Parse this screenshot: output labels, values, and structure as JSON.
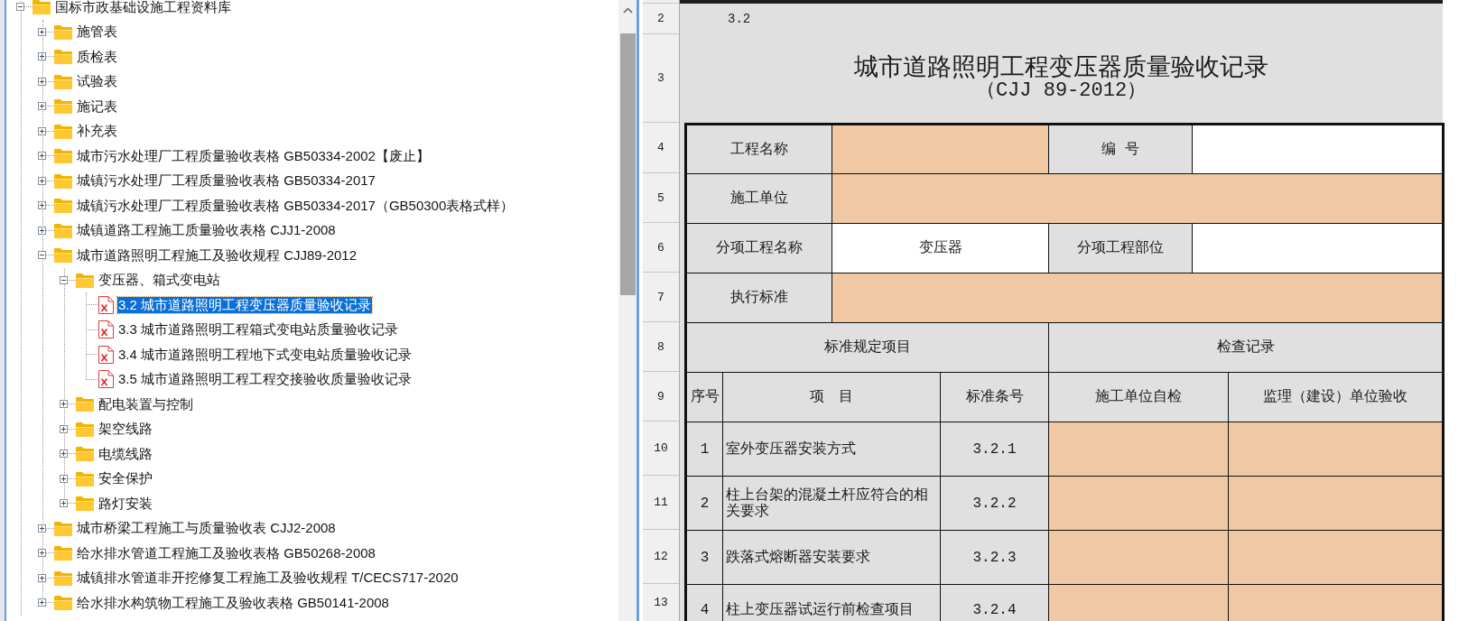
{
  "tree": [
    {
      "kind": "folder",
      "label": "国标市政基础设施工程资料库",
      "expanded": true,
      "selected": false,
      "children": [
        {
          "kind": "folder",
          "label": "施管表",
          "expanded": false,
          "selected": false
        },
        {
          "kind": "folder",
          "label": "质检表",
          "expanded": false,
          "selected": false
        },
        {
          "kind": "folder",
          "label": "试验表",
          "expanded": false,
          "selected": false
        },
        {
          "kind": "folder",
          "label": "施记表",
          "expanded": false,
          "selected": false
        },
        {
          "kind": "folder",
          "label": "补充表",
          "expanded": false,
          "selected": false
        },
        {
          "kind": "folder",
          "label": "城市污水处理厂工程质量验收表格 GB50334-2002【废止】",
          "expanded": false,
          "selected": false
        },
        {
          "kind": "folder",
          "label": "城镇污水处理厂工程质量验收表格 GB50334-2017",
          "expanded": false,
          "selected": false
        },
        {
          "kind": "folder",
          "label": "城镇污水处理厂工程质量验收表格 GB50334-2017（GB50300表格式样）",
          "expanded": false,
          "selected": false
        },
        {
          "kind": "folder",
          "label": "城镇道路工程施工质量验收表格 CJJ1-2008",
          "expanded": false,
          "selected": false
        },
        {
          "kind": "folder",
          "label": "城市道路照明工程施工及验收规程 CJJ89-2012",
          "expanded": true,
          "selected": false,
          "children": [
            {
              "kind": "folder",
              "label": "变压器、箱式变电站",
              "expanded": true,
              "selected": false,
              "children": [
                {
                  "kind": "file",
                  "label": "3.2 城市道路照明工程变压器质量验收记录",
                  "selected": true
                },
                {
                  "kind": "file",
                  "label": "3.3 城市道路照明工程箱式变电站质量验收记录",
                  "selected": false
                },
                {
                  "kind": "file",
                  "label": "3.4 城市道路照明工程地下式变电站质量验收记录",
                  "selected": false
                },
                {
                  "kind": "file",
                  "label": "3.5 城市道路照明工程工程交接验收质量验收记录",
                  "selected": false
                }
              ]
            },
            {
              "kind": "folder",
              "label": "配电装置与控制",
              "expanded": false,
              "selected": false
            },
            {
              "kind": "folder",
              "label": "架空线路",
              "expanded": false,
              "selected": false
            },
            {
              "kind": "folder",
              "label": "电缆线路",
              "expanded": false,
              "selected": false
            },
            {
              "kind": "folder",
              "label": "安全保护",
              "expanded": false,
              "selected": false
            },
            {
              "kind": "folder",
              "label": "路灯安装",
              "expanded": false,
              "selected": false
            }
          ]
        },
        {
          "kind": "folder",
          "label": "城市桥梁工程施工与质量验收表 CJJ2-2008",
          "expanded": false,
          "selected": false
        },
        {
          "kind": "folder",
          "label": "给水排水管道工程施工及验收表格 GB50268-2008",
          "expanded": false,
          "selected": false
        },
        {
          "kind": "folder",
          "label": "城镇排水管道非开挖修复工程施工及验收规程 T/CECS717-2020",
          "expanded": false,
          "selected": false
        },
        {
          "kind": "folder",
          "label": "给水排水构筑物工程施工及验收表格 GB50141-2008",
          "expanded": false,
          "selected": false
        }
      ]
    }
  ],
  "sheet": {
    "row_numbers": [
      "2",
      "3",
      "4",
      "5",
      "6",
      "7",
      "8",
      "9",
      "10",
      "11",
      "12",
      "13"
    ],
    "section_number": "3.2",
    "title": "城市道路照明工程变压器质量验收记录",
    "subtitle": "（CJJ 89-2012）",
    "form_rows": [
      {
        "cells": [
          {
            "kind": "label",
            "text": "工程名称"
          },
          {
            "kind": "input",
            "highlighted": true
          },
          {
            "kind": "label",
            "text": "编 号"
          },
          {
            "kind": "input",
            "highlighted": false
          }
        ]
      },
      {
        "cells": [
          {
            "kind": "label",
            "text": "施工单位"
          },
          {
            "kind": "input",
            "highlighted": true
          }
        ]
      },
      {
        "cells": [
          {
            "kind": "label",
            "text": "分项工程名称"
          },
          {
            "kind": "input",
            "highlighted": false,
            "value": "变压器"
          },
          {
            "kind": "label",
            "text": "分项工程部位"
          },
          {
            "kind": "input",
            "highlighted": false
          }
        ]
      },
      {
        "cells": [
          {
            "kind": "label",
            "text": "执行标准"
          },
          {
            "kind": "input",
            "highlighted": true
          }
        ]
      }
    ],
    "group_headers": [
      "标准规定项目",
      "检查记录"
    ],
    "columns": [
      "序号",
      "项　目",
      "标准条号",
      "施工单位自检",
      "监理（建设）单位验收"
    ],
    "check_rows": [
      {
        "number": "1",
        "item": "室外变压器安装方式",
        "clause": "3.2.1",
        "results": [
          {
            "highlighted": true
          },
          {
            "highlighted": true
          }
        ]
      },
      {
        "number": "2",
        "item": "柱上台架的混凝土杆应符合的相关要求",
        "clause": "3.2.2",
        "results": [
          {
            "highlighted": true
          },
          {
            "highlighted": true
          }
        ]
      },
      {
        "number": "3",
        "item": "跌落式熔断器安装要求",
        "clause": "3.2.3",
        "results": [
          {
            "highlighted": true
          },
          {
            "highlighted": true
          }
        ]
      },
      {
        "number": "4",
        "item": "柱上变压器试运行前检查项目",
        "clause": "3.2.4",
        "results": [
          {
            "highlighted": true
          },
          {
            "highlighted": true
          }
        ]
      }
    ]
  }
}
